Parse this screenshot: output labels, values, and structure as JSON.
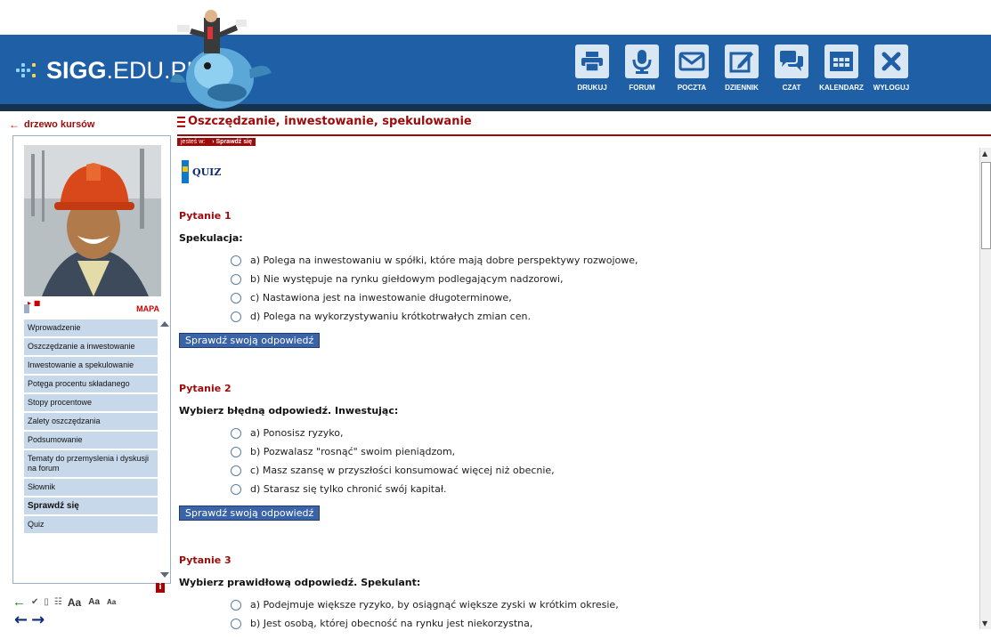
{
  "header": {
    "logo_bold": "SIGG",
    "logo_rest": ".EDU.PL",
    "toolbar": [
      {
        "label": "DRUKUJ",
        "icon": "printer-icon"
      },
      {
        "label": "FORUM",
        "icon": "microphone-icon"
      },
      {
        "label": "POCZTA",
        "icon": "mail-icon"
      },
      {
        "label": "DZIENNIK",
        "icon": "edit-icon"
      },
      {
        "label": "CZAT",
        "icon": "chat-icon"
      },
      {
        "label": "KALENDARZ",
        "icon": "calendar-icon"
      },
      {
        "label": "WYLOGUJ",
        "icon": "close-icon"
      }
    ]
  },
  "sidebar": {
    "back_link": "drzewo kursów",
    "mapa": "MAPA",
    "items": [
      {
        "label": "Wprowadzenie"
      },
      {
        "label": "Oszczędzanie a inwestowanie"
      },
      {
        "label": "Inwestowanie a spekulowanie"
      },
      {
        "label": "Potęga procentu składanego"
      },
      {
        "label": "Stopy procentowe"
      },
      {
        "label": "Zalety oszczędzania"
      },
      {
        "label": "Podsumowanie"
      },
      {
        "label": "Tematy do przemyslenia i dyskusji na forum"
      },
      {
        "label": "Słownik"
      },
      {
        "label": "Sprawdź się"
      },
      {
        "label": "Quiz"
      }
    ],
    "active_index": 9,
    "font_sizes": [
      "Aa",
      "Aa",
      "Aa"
    ],
    "info": "i"
  },
  "main": {
    "title": "Oszczędzanie, inwestowanie, spekulowanie",
    "crumb_prefix": "jesteś w:",
    "crumb_current": "› Sprawdź się",
    "quiz_label": "QUIZ",
    "check_button": "Sprawdź swoją odpowiedź",
    "questions": [
      {
        "title": "Pytanie 1",
        "text": "Spekulacja:",
        "answers": [
          "a) Polega na inwestowaniu w spółki, które mają dobre perspektywy rozwojowe,",
          "b) Nie występuje na rynku giełdowym podlegającym nadzorowi,",
          "c) Nastawiona jest na inwestowanie długoterminowe,",
          "d) Polega na wykorzystywaniu krótkotrwałych zmian cen."
        ]
      },
      {
        "title": "Pytanie 2",
        "text": "Wybierz błędną odpowiedź. Inwestując:",
        "answers": [
          "a) Ponosisz ryzyko,",
          "b) Pozwalasz \"rosnąć\" swoim pieniądzom,",
          "c) Masz szansę w przyszłości konsumować więcej niż obecnie,",
          "d) Starasz się tylko chronić swój kapitał."
        ]
      },
      {
        "title": "Pytanie 3",
        "text": "Wybierz prawidłową odpowiedź. Spekulant:",
        "answers": [
          "a) Podejmuje większe ryzyko, by osiągnąć większe zyski w krótkim okresie,",
          "b) Jest osobą, której obecność na rynku jest niekorzystna,"
        ]
      }
    ]
  },
  "colors": {
    "header_blue": "#1f5fa6",
    "dark_red": "#9c0a0a",
    "menu_bg": "#c8d8eb",
    "button_blue": "#3a63a8"
  }
}
